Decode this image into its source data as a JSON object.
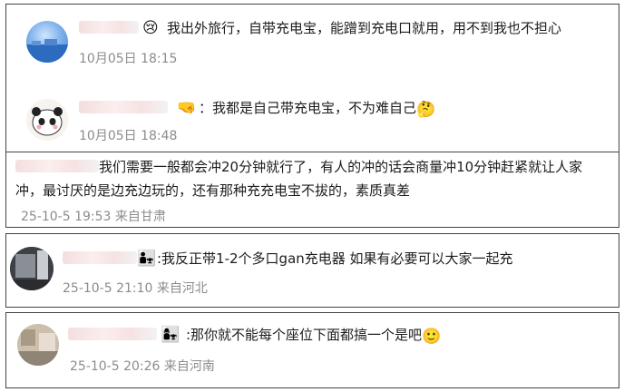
{
  "comments": [
    {
      "text": "我出外旅行，自带充电宝，能蹭到充电口就用，用不到我也不担心",
      "date": "10月05日",
      "time": "18:15",
      "badge": "😢"
    },
    {
      "text": "：我都是自己带充电宝，不为难自己",
      "date": "10月05日",
      "time": "18:48",
      "badge": "🤜",
      "trailing_emoji": "🤔"
    },
    {
      "text_line1": "我们需要一般都会冲20分钟就行了，有人的冲的话会商量冲10分钟赶紧就让人家",
      "text_line2": "冲，最讨厌的是边充边玩的，还有那种充充电宝不拔的，素质真差",
      "meta": "25-10-5 19:53 来自甘肃"
    },
    {
      "text": ":我反正带1-2个多口gan充电器 如果有必要可以大家一起充",
      "meta": "25-10-5 21:10 来自河北",
      "badge": "👨‍👧"
    },
    {
      "text": ":那你就不能每个座位下面都搞一个是吧",
      "meta": "25-10-5 20:26 来自河南",
      "badge": "👩‍👧",
      "trailing_emoji": "🙂"
    }
  ]
}
